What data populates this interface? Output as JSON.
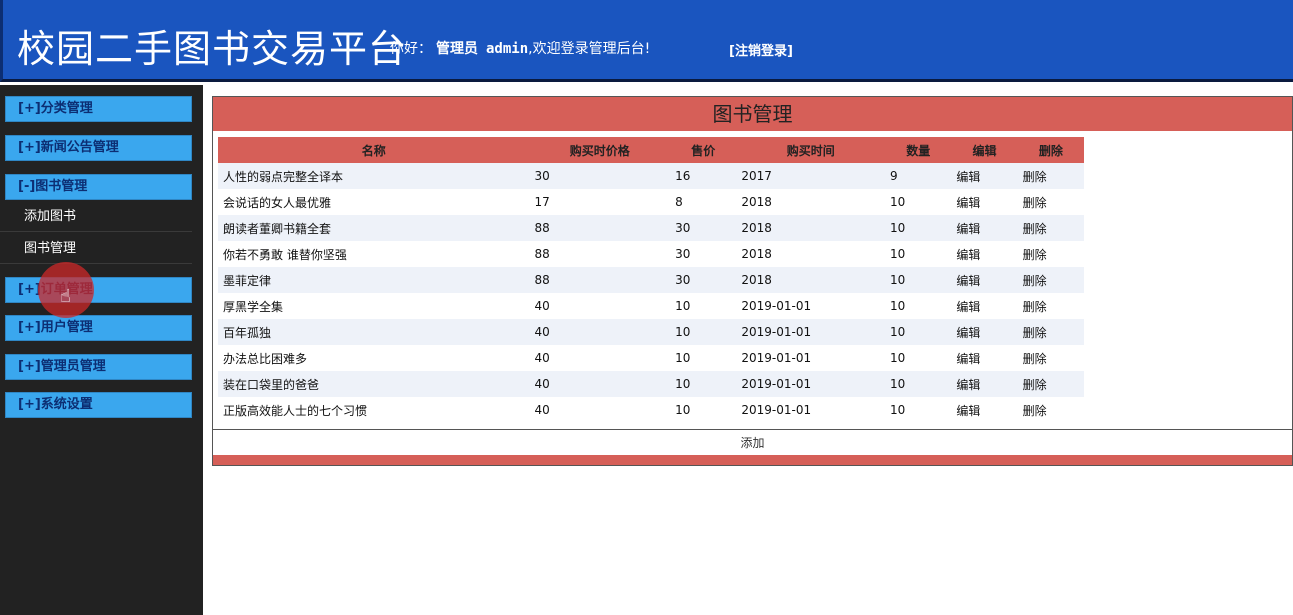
{
  "header": {
    "site_title": "校园二手图书交易平台",
    "greeting": "你好：",
    "role": "管理员",
    "username": "admin",
    "welcome_text": ",欢迎登录管理后台!",
    "logout_label": "[注销登录]"
  },
  "sidebar": {
    "groups": [
      {
        "label": "[+]分类管理"
      },
      {
        "label": "[+]新闻公告管理"
      },
      {
        "label": "[-]图书管理"
      },
      {
        "label": "[+]订单管理"
      },
      {
        "label": "[+]用户管理"
      },
      {
        "label": "[+]管理员管理"
      },
      {
        "label": "[+]系统设置"
      }
    ],
    "book_sub_items": [
      {
        "label": "添加图书"
      },
      {
        "label": "图书管理"
      }
    ]
  },
  "main": {
    "title": "图书管理",
    "columns": [
      "名称",
      "购买时价格",
      "售价",
      "购买时间",
      "数量",
      "编辑",
      "删除"
    ],
    "rows": [
      {
        "name": "人性的弱点完整全译本",
        "buy_price": "30",
        "price": "16",
        "buy_time": "2017",
        "qty": "9",
        "edit": "编辑",
        "delete": "删除"
      },
      {
        "name": "会说话的女人最优雅",
        "buy_price": "17",
        "price": "8",
        "buy_time": "2018",
        "qty": "10",
        "edit": "编辑",
        "delete": "删除"
      },
      {
        "name": "朗读者董卿书籍全套",
        "buy_price": "88",
        "price": "30",
        "buy_time": "2018",
        "qty": "10",
        "edit": "编辑",
        "delete": "删除"
      },
      {
        "name": "你若不勇敢 谁替你坚强",
        "buy_price": "88",
        "price": "30",
        "buy_time": "2018",
        "qty": "10",
        "edit": "编辑",
        "delete": "删除"
      },
      {
        "name": "墨菲定律",
        "buy_price": "88",
        "price": "30",
        "buy_time": "2018",
        "qty": "10",
        "edit": "编辑",
        "delete": "删除"
      },
      {
        "name": "厚黑学全集",
        "buy_price": "40",
        "price": "10",
        "buy_time": "2019-01-01",
        "qty": "10",
        "edit": "编辑",
        "delete": "删除"
      },
      {
        "name": "百年孤独",
        "buy_price": "40",
        "price": "10",
        "buy_time": "2019-01-01",
        "qty": "10",
        "edit": "编辑",
        "delete": "删除"
      },
      {
        "name": "办法总比困难多",
        "buy_price": "40",
        "price": "10",
        "buy_time": "2019-01-01",
        "qty": "10",
        "edit": "编辑",
        "delete": "删除"
      },
      {
        "name": "装在口袋里的爸爸",
        "buy_price": "40",
        "price": "10",
        "buy_time": "2019-01-01",
        "qty": "10",
        "edit": "编辑",
        "delete": "删除"
      },
      {
        "name": "正版高效能人士的七个习惯",
        "buy_price": "40",
        "price": "10",
        "buy_time": "2019-01-01",
        "qty": "10",
        "edit": "编辑",
        "delete": "删除"
      }
    ],
    "add_label": "添加"
  },
  "colors": {
    "header_bg": "#1a55bf",
    "sidebar_bg": "#222222",
    "menu_bg": "#3aa7ee",
    "accent_red": "#d65f58",
    "row_alt": "#eef2f9"
  },
  "icons": {
    "cursor": "hand-pointer-icon"
  }
}
